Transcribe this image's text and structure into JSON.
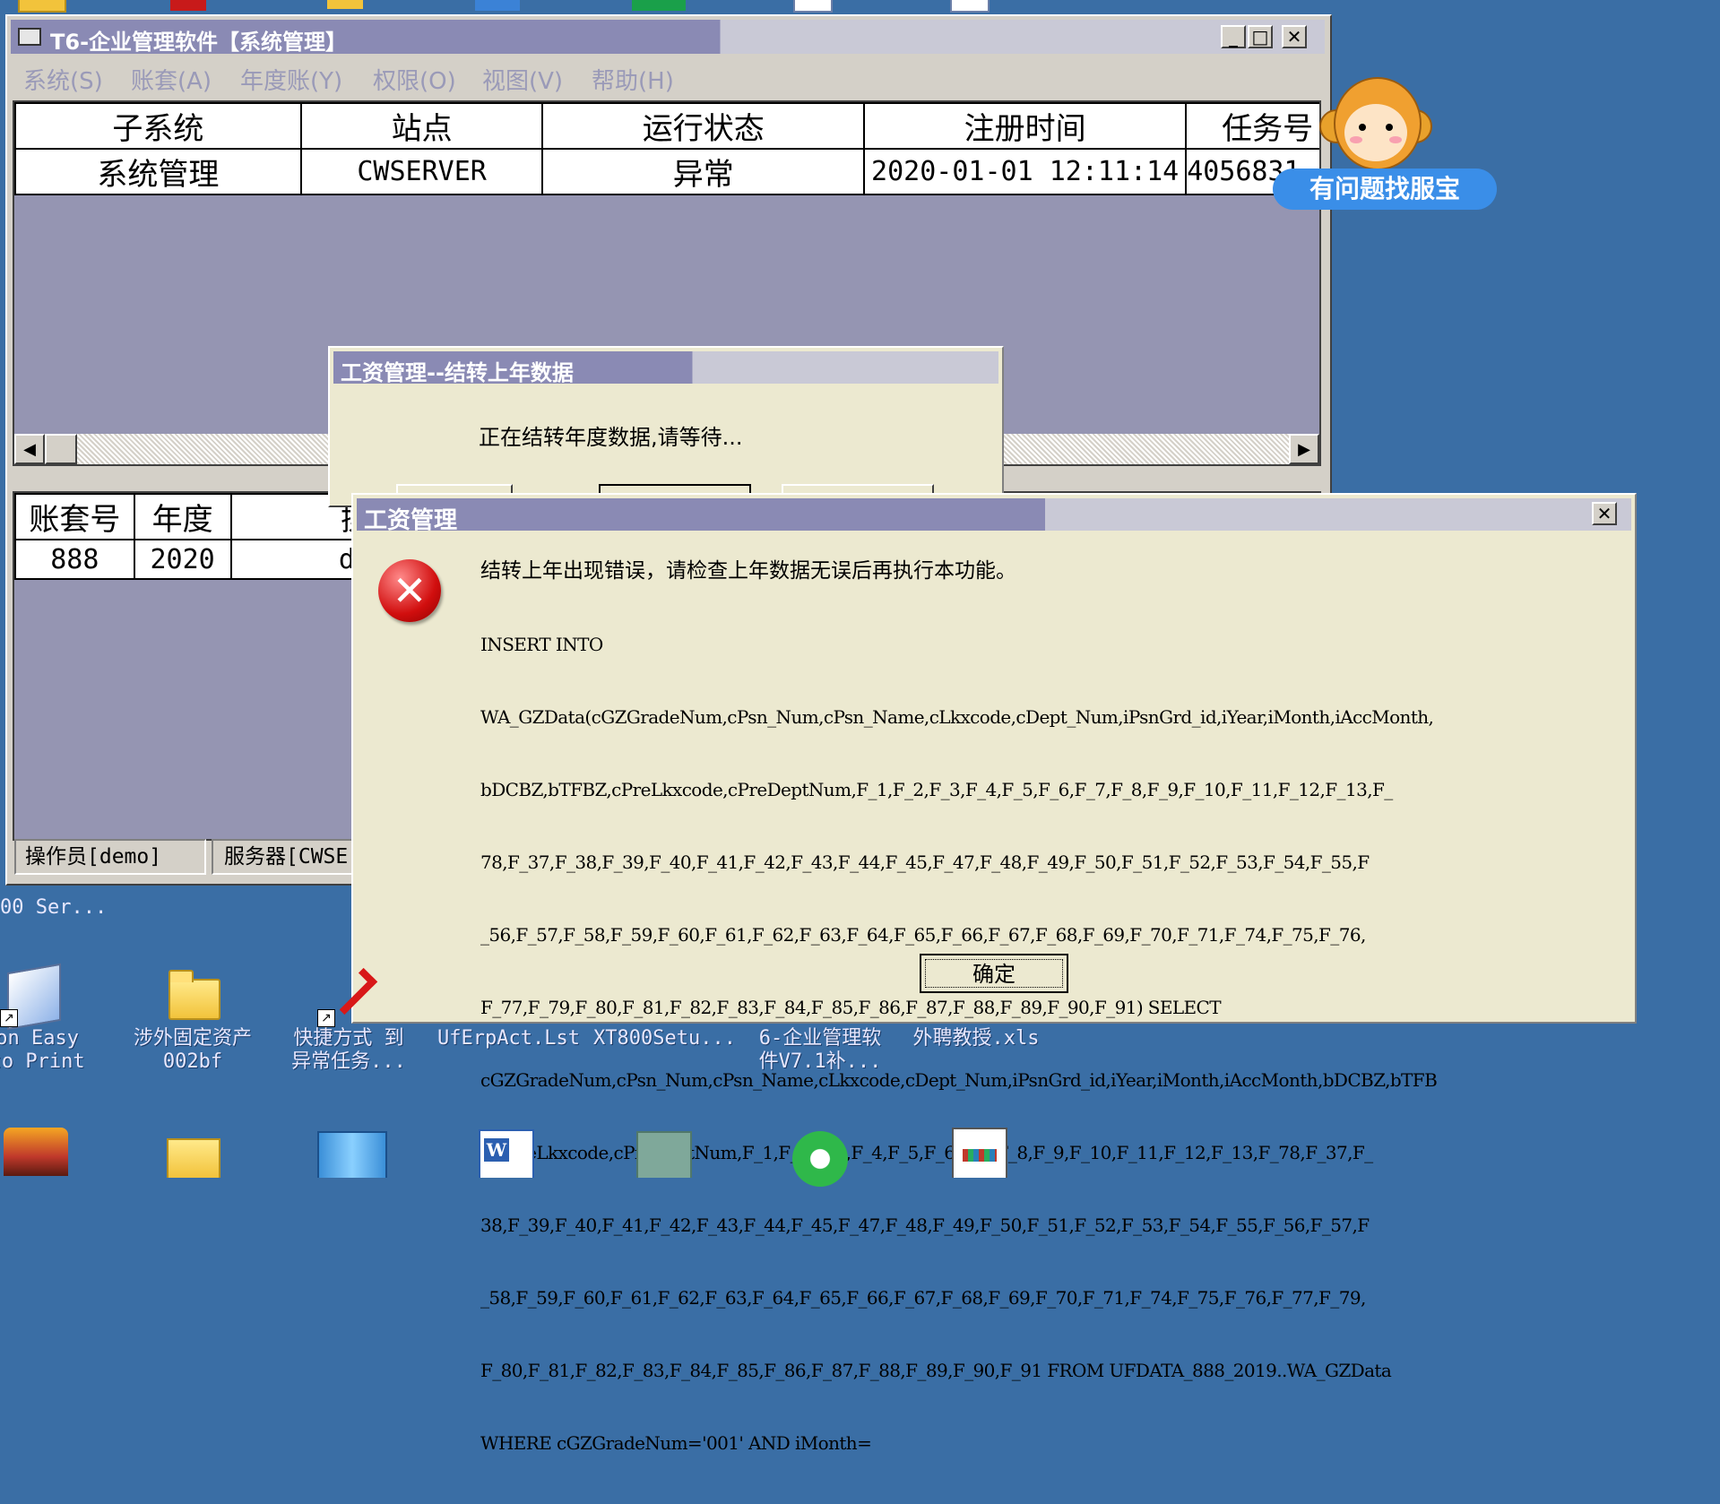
{
  "main_window": {
    "title": "T6-企业管理软件【系统管理】",
    "menu": [
      "系统(S)",
      "账套(A)",
      "年度账(Y)",
      "权限(O)",
      "视图(V)",
      "帮助(H)"
    ],
    "top_table": {
      "headers": [
        "子系统",
        "站点",
        "运行状态",
        "注册时间",
        "任务号"
      ],
      "row": [
        "系统管理",
        "CWSERVER",
        "异常",
        "2020-01-01 12:11:14",
        "4056831"
      ]
    },
    "bottom_table": {
      "headers": [
        "账套号",
        "年度",
        "操"
      ],
      "row": [
        "888",
        "2020",
        "de"
      ]
    },
    "status": {
      "operator": "操作员[demo]",
      "server": "服务器[CWSE"
    }
  },
  "mascot": {
    "bubble_text": "有问题找服宝"
  },
  "progress_dialog": {
    "title": "工资管理--结转上年数据",
    "message": "正在结转年度数据,请等待..."
  },
  "error_dialog": {
    "title": "工资管理",
    "heading": "结转上年出现错误，请检查上年数据无误后再执行本功能。",
    "lines": [
      "INSERT INTO",
      "WA_GZData(cGZGradeNum,cPsn_Num,cPsn_Name,cLkxcode,cDept_Num,iPsnGrd_id,iYear,iMonth,iAccMonth,",
      "bDCBZ,bTFBZ,cPreLkxcode,cPreDeptNum,F_1,F_2,F_3,F_4,F_5,F_6,F_7,F_8,F_9,F_10,F_11,F_12,F_13,F_",
      "78,F_37,F_38,F_39,F_40,F_41,F_42,F_43,F_44,F_45,F_47,F_48,F_49,F_50,F_51,F_52,F_53,F_54,F_55,F",
      "_56,F_57,F_58,F_59,F_60,F_61,F_62,F_63,F_64,F_65,F_66,F_67,F_68,F_69,F_70,F_71,F_74,F_75,F_76,",
      "F_77,F_79,F_80,F_81,F_82,F_83,F_84,F_85,F_86,F_87,F_88,F_89,F_90,F_91) SELECT",
      "cGZGradeNum,cPsn_Num,cPsn_Name,cLkxcode,cDept_Num,iPsnGrd_id,iYear,iMonth,iAccMonth,bDCBZ,bTFB",
      "Z,cPreLkxcode,cPreDeptNum,F_1,F_2,F_3,F_4,F_5,F_6,F_7,F_8,F_9,F_10,F_11,F_12,F_13,F_78,F_37,F_",
      "38,F_39,F_40,F_41,F_42,F_43,F_44,F_45,F_47,F_48,F_49,F_50,F_51,F_52,F_53,F_54,F_55,F_56,F_57,F",
      "_58,F_59,F_60,F_61,F_62,F_63,F_64,F_65,F_66,F_67,F_68,F_69,F_70,F_71,F_74,F_75,F_76,F_77,F_79,",
      "F_80,F_81,F_82,F_83,F_84,F_85,F_86,F_87,F_88,F_89,F_90,F_91 FROM UFDATA_888_2019..WA_GZData",
      "WHERE cGZGradeNum='001' AND iMonth="
    ],
    "ok_label": "确定"
  },
  "desktop": {
    "partial_labels": [
      "00 Ser..."
    ],
    "icons": [
      {
        "line1": "son Easy",
        "line2": "oto Print",
        "icon": "epson-print-icon"
      },
      {
        "line1": "涉外固定资产",
        "line2": "002bf",
        "icon": "folder-icon"
      },
      {
        "line1": "快捷方式 到",
        "line2": "异常任务...",
        "icon": "shortcut-icon"
      },
      {
        "line1": "UfErpAct.Lst",
        "line2": "",
        "icon": "file-icon"
      },
      {
        "line1": "XT800Setu...",
        "line2": "",
        "icon": "setup-icon"
      },
      {
        "line1": "6-企业管理软",
        "line2": "件V7.1补...",
        "icon": "folder-icon"
      },
      {
        "line1": "外聘教授.xls",
        "line2": "",
        "icon": "excel-icon"
      }
    ]
  }
}
